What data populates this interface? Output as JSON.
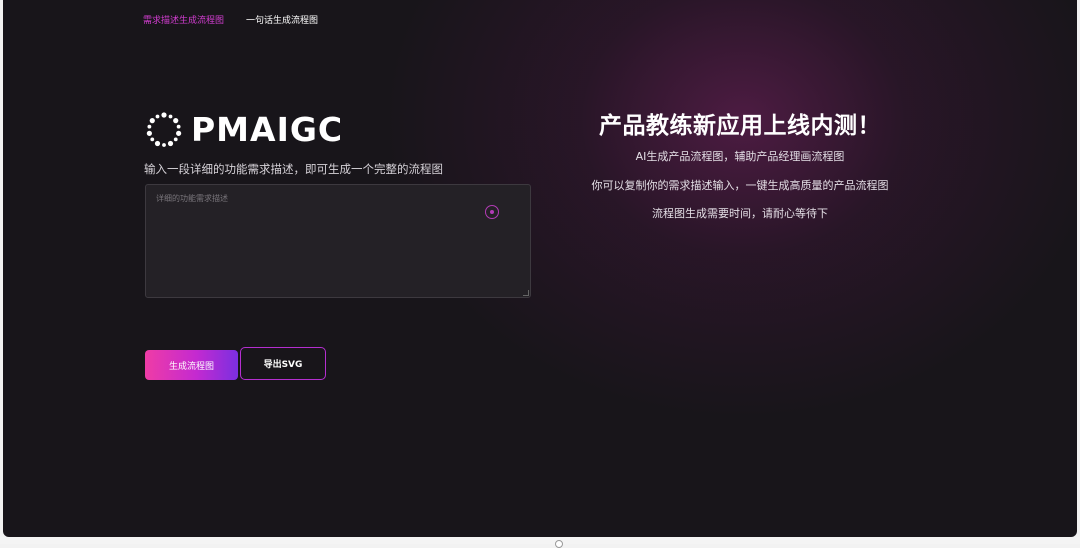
{
  "nav": {
    "tabs": [
      {
        "label": "需求描述生成流程图",
        "active": true
      },
      {
        "label": "一句话生成流程图",
        "active": false
      }
    ]
  },
  "logo": {
    "text": "PMAIGC",
    "icon": "dotted-ring-logo"
  },
  "main": {
    "subtitle": "输入一段详细的功能需求描述，即可生成一个完整的流程图",
    "textarea_placeholder": "详细的功能需求描述",
    "textarea_value": "",
    "mic_icon": "record-icon"
  },
  "buttons": {
    "generate": "生成流程图",
    "export": "导出SVG"
  },
  "promo": {
    "title": "产品教练新应用上线内测！",
    "lines": [
      "AI生成产品流程图，辅助产品经理画流程图",
      "你可以复制你的需求描述输入，一键生成高质量的产品流程图",
      "流程图生成需要时间，请耐心等待下"
    ]
  },
  "colors": {
    "accent": "#d23dd0",
    "background": "#18151a",
    "gradient_start": "#ef3ca6",
    "gradient_end": "#7b2fe0"
  }
}
